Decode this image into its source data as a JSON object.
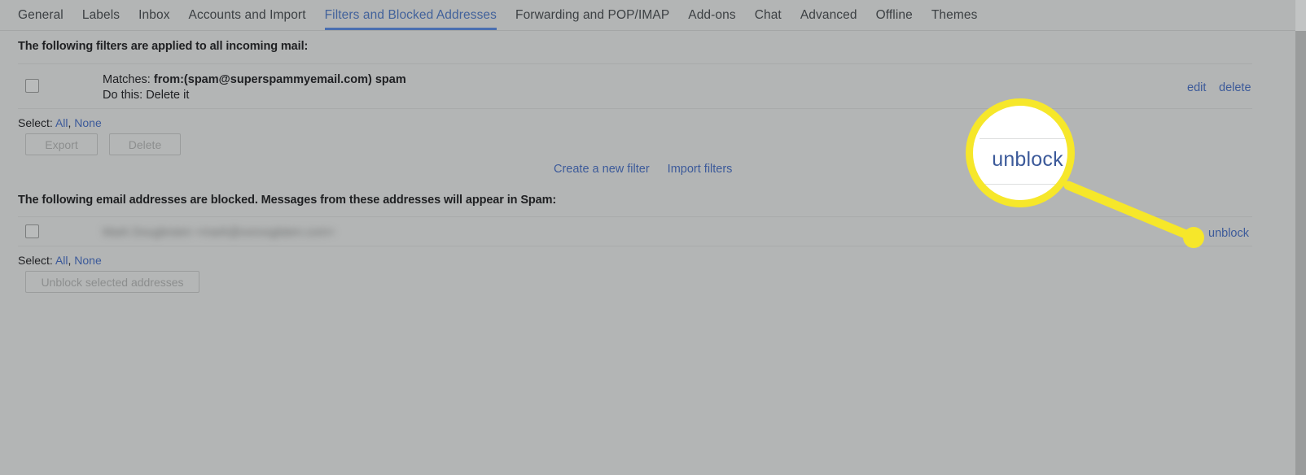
{
  "tabs": [
    {
      "label": "General",
      "active": false
    },
    {
      "label": "Labels",
      "active": false
    },
    {
      "label": "Inbox",
      "active": false
    },
    {
      "label": "Accounts and Import",
      "active": false
    },
    {
      "label": "Filters and Blocked Addresses",
      "active": true
    },
    {
      "label": "Forwarding and POP/IMAP",
      "active": false
    },
    {
      "label": "Add-ons",
      "active": false
    },
    {
      "label": "Chat",
      "active": false
    },
    {
      "label": "Advanced",
      "active": false
    },
    {
      "label": "Offline",
      "active": false
    },
    {
      "label": "Themes",
      "active": false
    }
  ],
  "filters_section": {
    "heading": "The following filters are applied to all incoming mail:",
    "rows": [
      {
        "matches_label": "Matches:",
        "matches_value": "from:(spam@superspammyemail.com) spam",
        "action_label": "Do this:",
        "action_value": "Delete it",
        "edit_link": "edit",
        "delete_link": "delete"
      }
    ],
    "select_label": "Select:",
    "select_all": "All",
    "select_separator": ",",
    "select_none": "None",
    "export_button": "Export",
    "delete_button": "Delete",
    "create_filter_link": "Create a new filter",
    "import_filters_link": "Import filters"
  },
  "blocked_section": {
    "heading": "The following email addresses are blocked. Messages from these addresses will appear in Spam:",
    "rows": [
      {
        "address": "Mark Douglesten <mark@oorooglaten.com>",
        "unblock_link": "unblock"
      }
    ],
    "select_label": "Select:",
    "select_all": "All",
    "select_separator": ",",
    "select_none": "None",
    "unblock_button": "Unblock selected addresses"
  },
  "callout": {
    "magnified_label": "unblock",
    "highlight_color": "#f6e72a",
    "link_color": "#3c5a9a"
  }
}
